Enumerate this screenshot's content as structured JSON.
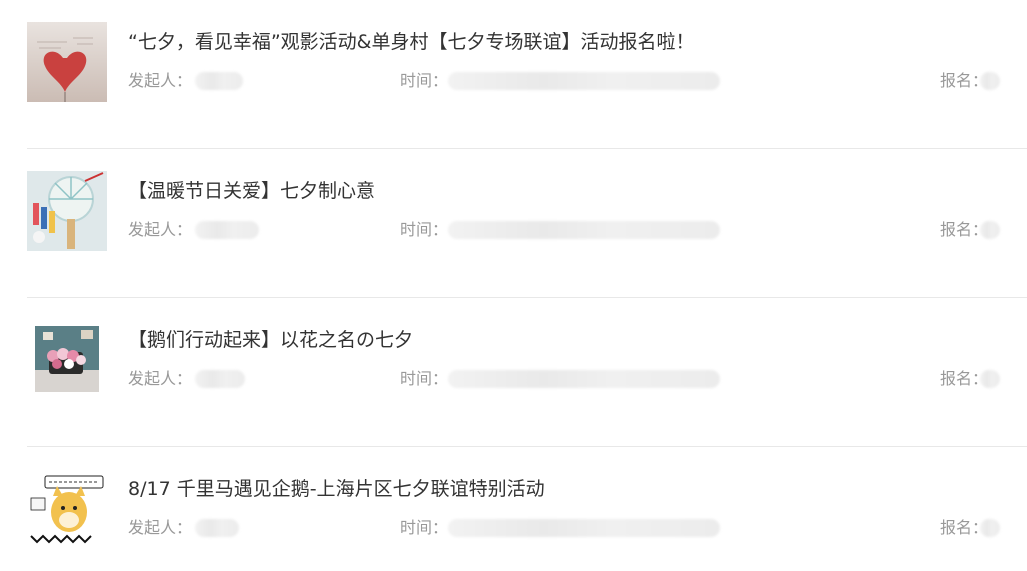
{
  "events": [
    {
      "title": "“七夕，看见幸福”观影活动&单身村【七夕专场联谊】活动报名啦！",
      "organizer_label": "发起人：",
      "time_label": "时间：",
      "signup_label": "报名：",
      "thumb_icon": "heart-balloon-image"
    },
    {
      "title": "【温暖节日关爱】七夕制心意",
      "organizer_label": "发起人：",
      "time_label": "时间：",
      "signup_label": "报名：",
      "thumb_icon": "paint-fan-image"
    },
    {
      "title": "【鹅们行动起来】以花之名の七夕",
      "organizer_label": "发起人：",
      "time_label": "时间：",
      "signup_label": "报名：",
      "thumb_icon": "flower-basket-image"
    },
    {
      "title": "8/17 千里马遇见企鹅-上海片区七夕联谊特别活动",
      "organizer_label": "发起人：",
      "time_label": "时间：",
      "signup_label": "报名：",
      "thumb_icon": "shiba-cartoon-image"
    }
  ]
}
